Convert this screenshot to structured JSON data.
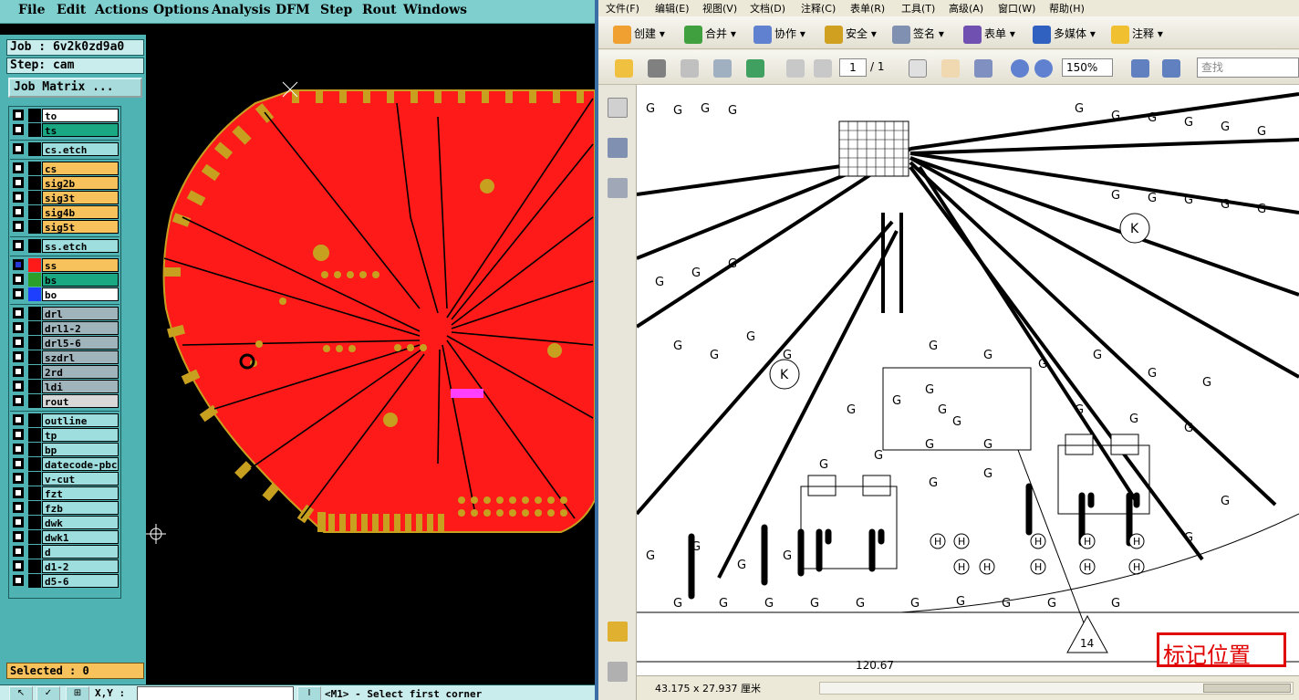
{
  "cam": {
    "menu": [
      "File",
      "Edit",
      "Actions",
      "Options",
      "Analysis",
      "DFM",
      "Step",
      "Rout",
      "Windows"
    ],
    "job_label": "Job : 6v2k0zd9a0",
    "step_label": "Step: cam",
    "job_matrix_label": "Job Matrix ...",
    "layers": [
      {
        "name": "to",
        "bg": "#ffffff",
        "swatch": "#000000",
        "checked": false
      },
      {
        "name": "ts",
        "bg": "#1aa883",
        "swatch": "#000000",
        "checked": false
      },
      {
        "name": "cs.etch",
        "bg": "#9fdede",
        "swatch": "#000000",
        "checked": false
      },
      {
        "name": "cs",
        "bg": "#f7c15c",
        "swatch": "#000000",
        "checked": false
      },
      {
        "name": "sig2b",
        "bg": "#f7c15c",
        "swatch": "#000000",
        "checked": false
      },
      {
        "name": "sig3t",
        "bg": "#f7c15c",
        "swatch": "#000000",
        "checked": false
      },
      {
        "name": "sig4b",
        "bg": "#f7c15c",
        "swatch": "#000000",
        "checked": false
      },
      {
        "name": "sig5t",
        "bg": "#f7c15c",
        "swatch": "#000000",
        "checked": false
      },
      {
        "name": "ss.etch",
        "bg": "#9fdede",
        "swatch": "#000000",
        "checked": false
      },
      {
        "name": "ss",
        "bg": "#f7c15c",
        "swatch": "#ff1a1a",
        "checked": true
      },
      {
        "name": "bs",
        "bg": "#1aa883",
        "swatch": "#2aa02a",
        "checked": false
      },
      {
        "name": "bo",
        "bg": "#ffffff",
        "swatch": "#1f3fff",
        "checked": false
      },
      {
        "name": "drl",
        "bg": "#a0b4bc",
        "swatch": "#000000",
        "checked": false
      },
      {
        "name": "drl1-2",
        "bg": "#a0b4bc",
        "swatch": "#000000",
        "checked": false
      },
      {
        "name": "drl5-6",
        "bg": "#a0b4bc",
        "swatch": "#000000",
        "checked": false
      },
      {
        "name": "szdrl",
        "bg": "#a0b4bc",
        "swatch": "#000000",
        "checked": false
      },
      {
        "name": "2rd",
        "bg": "#a0b4bc",
        "swatch": "#000000",
        "checked": false
      },
      {
        "name": "ldi",
        "bg": "#a0b4bc",
        "swatch": "#000000",
        "checked": false
      },
      {
        "name": "rout",
        "bg": "#d8d8d8",
        "swatch": "#000000",
        "checked": false
      },
      {
        "name": "outline",
        "bg": "#9fdede",
        "swatch": "#000000",
        "checked": false
      },
      {
        "name": "tp",
        "bg": "#9fdede",
        "swatch": "#000000",
        "checked": false
      },
      {
        "name": "bp",
        "bg": "#9fdede",
        "swatch": "#000000",
        "checked": false
      },
      {
        "name": "datecode-pbc",
        "bg": "#9fdede",
        "swatch": "#000000",
        "checked": false
      },
      {
        "name": "v-cut",
        "bg": "#9fdede",
        "swatch": "#000000",
        "checked": false
      },
      {
        "name": "fzt",
        "bg": "#9fdede",
        "swatch": "#000000",
        "checked": false
      },
      {
        "name": "fzb",
        "bg": "#9fdede",
        "swatch": "#000000",
        "checked": false
      },
      {
        "name": "dwk",
        "bg": "#9fdede",
        "swatch": "#000000",
        "checked": false
      },
      {
        "name": "dwk1",
        "bg": "#9fdede",
        "swatch": "#000000",
        "checked": false
      },
      {
        "name": "d",
        "bg": "#9fdede",
        "swatch": "#000000",
        "checked": false
      },
      {
        "name": "d1-2",
        "bg": "#9fdede",
        "swatch": "#000000",
        "checked": false
      },
      {
        "name": "d5-6",
        "bg": "#9fdede",
        "swatch": "#000000",
        "checked": false
      }
    ],
    "selected_label": "Selected : 0",
    "xy_label": "X,Y :",
    "status_message": "<M1> - Select first corner",
    "colors": {
      "board": "#ff1a1a",
      "pad": "#c8a020",
      "bg": "#000000"
    }
  },
  "pdf": {
    "menu": [
      "文件(F)",
      "编辑(E)",
      "视图(V)",
      "文档(D)",
      "注释(C)",
      "表单(R)",
      "工具(T)",
      "高级(A)",
      "窗口(W)",
      "帮助(H)"
    ],
    "toolbar1": [
      {
        "label": "创建",
        "icon": "create-icon"
      },
      {
        "label": "合并",
        "icon": "merge-icon"
      },
      {
        "label": "协作",
        "icon": "collaborate-icon"
      },
      {
        "label": "安全",
        "icon": "lock-icon"
      },
      {
        "label": "签名",
        "icon": "pen-icon"
      },
      {
        "label": "表单",
        "icon": "form-icon"
      },
      {
        "label": "多媒体",
        "icon": "multimedia-icon"
      },
      {
        "label": "注释",
        "icon": "comment-icon"
      }
    ],
    "page_current": "1",
    "page_total": "/ 1",
    "zoom": "150%",
    "find_placeholder": "查找",
    "doc_size": "43.175 x 27.937 厘米",
    "dimension_text": "120.67",
    "marker_number": "14",
    "mark_label": "标记位置",
    "colors": {
      "annotation": "#e00000"
    }
  }
}
